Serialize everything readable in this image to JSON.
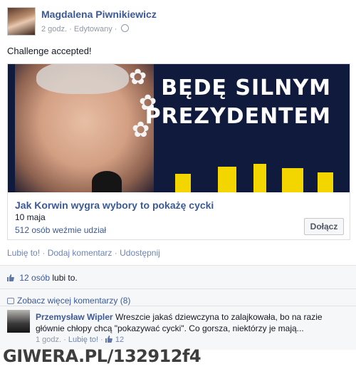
{
  "post": {
    "author": "Magdalena Piwnikiewicz",
    "time": "2 godz.",
    "edited": "Edytowany",
    "meta_sep": "·",
    "privacy_icon": "globe-icon",
    "message": "Challenge accepted!"
  },
  "event_card": {
    "banner_line1": "BĘDĘ SILNYM",
    "banner_line2": "PREZYDENTEM",
    "title": "Jak Korwin wygra wybory to pokażę cycki",
    "date": "10 maja",
    "attendees": "512 osób weźmie udział",
    "join_label": "Dołącz"
  },
  "actions": {
    "like": "Lubię to!",
    "comment": "Dodaj komentarz",
    "share": "Udostępnij",
    "sep": " · "
  },
  "ufi": {
    "likes_count": "12 osób",
    "likes_suffix": "lubi to.",
    "more_comments": "Zobacz więcej komentarzy (8)"
  },
  "comment": {
    "author": "Przemysław Wipler",
    "text": "Wreszcie jakaś dziewczyna to zalajkowała, bo na razie głównie chłopy chcą \"pokazywać cycki\". Co gorsza, niektórzy je mają...",
    "time": "1 godz.",
    "like": "Lubię to!",
    "likes": "12"
  },
  "watermark": "GIWERA.PL/132912f4",
  "colors": {
    "link": "#3b5998",
    "muted": "#9197a3",
    "banner_bg": "#101a3d",
    "banner_accent": "#f3d600"
  }
}
